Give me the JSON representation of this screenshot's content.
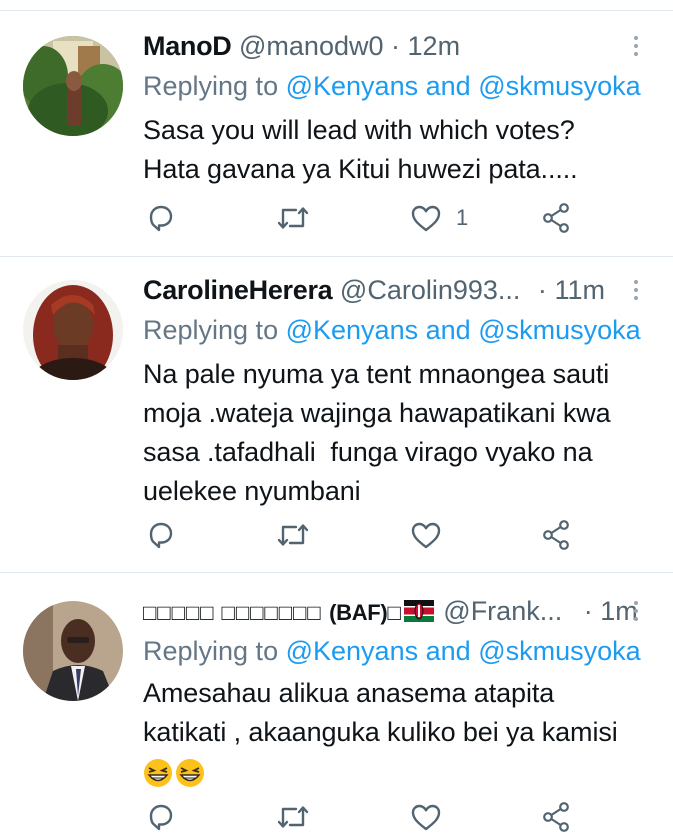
{
  "tweets": [
    {
      "name": "ManoD",
      "handle": "@manodw0",
      "separator": "·",
      "time": "12m",
      "replying_prefix": "Replying to",
      "mention_1": "@Kenyans",
      "connector": "and",
      "mention_2": "@skmusyoka",
      "text_lines": [
        "Sasa you will lead with which votes?",
        "Hata gavana ya Kitui huwezi pata....."
      ],
      "like_count": "1"
    },
    {
      "name": "CarolineHerera",
      "handle": "@Carolin993...",
      "separator": "·",
      "time": "11m",
      "replying_prefix": "Replying to",
      "mention_1": "@Kenyans",
      "connector": "and",
      "mention_2": "@skmusyoka",
      "text_lines": [
        "Na pale nyuma ya tent mnaongea sauti",
        "moja .wateja wajinga hawapatikani kwa",
        "sasa .tafadhali  funga virago vyako na",
        "uelekee nyumbani"
      ],
      "like_count": ""
    },
    {
      "name_boxes": "□□□□□ □□□□□□□",
      "name_tag": "(BAF)",
      "name_box_after": "□",
      "handle": "@Frank...",
      "separator": "·",
      "time": "1m",
      "replying_prefix": "Replying to",
      "mention_1": "@Kenyans",
      "connector": "and",
      "mention_2": "@skmusyoka",
      "text_lines": [
        "Amesahau alikua anasema atapita",
        "katikati , akaanguka kuliko bei ya kamisi"
      ],
      "like_count": ""
    }
  ],
  "icons": [
    "reply-icon",
    "retweet-icon",
    "like-icon",
    "share-icon",
    "more-icon"
  ],
  "colors": {
    "link": "#1d9bf0",
    "secondary": "#536471",
    "divider": "#e1e8ed"
  }
}
